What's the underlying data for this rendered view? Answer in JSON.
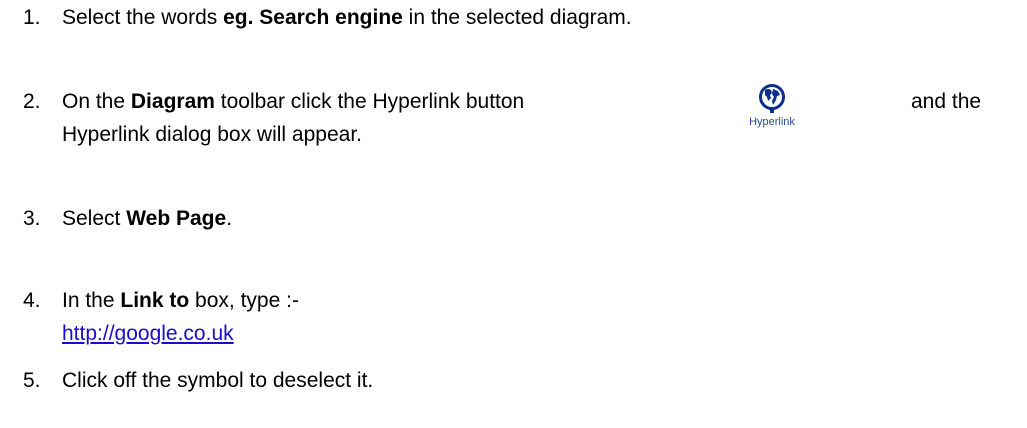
{
  "steps": [
    {
      "num": "1.",
      "pre": "Select the words ",
      "bold": "eg. Search engine",
      "post": " in the selected diagram."
    },
    {
      "num": "2.",
      "pre": "On the ",
      "bold": "Diagram",
      "post": " toolbar click the Hyperlink button",
      "after": "and the",
      "line2": "Hyperlink dialog box will appear."
    },
    {
      "num": "3.",
      "pre": "Select ",
      "bold": "Web Page",
      "post": "."
    },
    {
      "num": "4.",
      "pre": "In the ",
      "bold": "Link to",
      "post": " box, type :-",
      "link": "http://google.co.uk"
    },
    {
      "num": "5.",
      "text": "Click off the symbol to deselect it."
    }
  ],
  "toolbar_button": {
    "label": "Hyperlink",
    "icon": "globe-icon"
  },
  "colors": {
    "link": "#1a0dcc",
    "icon_blue": "#0a2f8c",
    "icon_label": "#2a4a9a"
  }
}
